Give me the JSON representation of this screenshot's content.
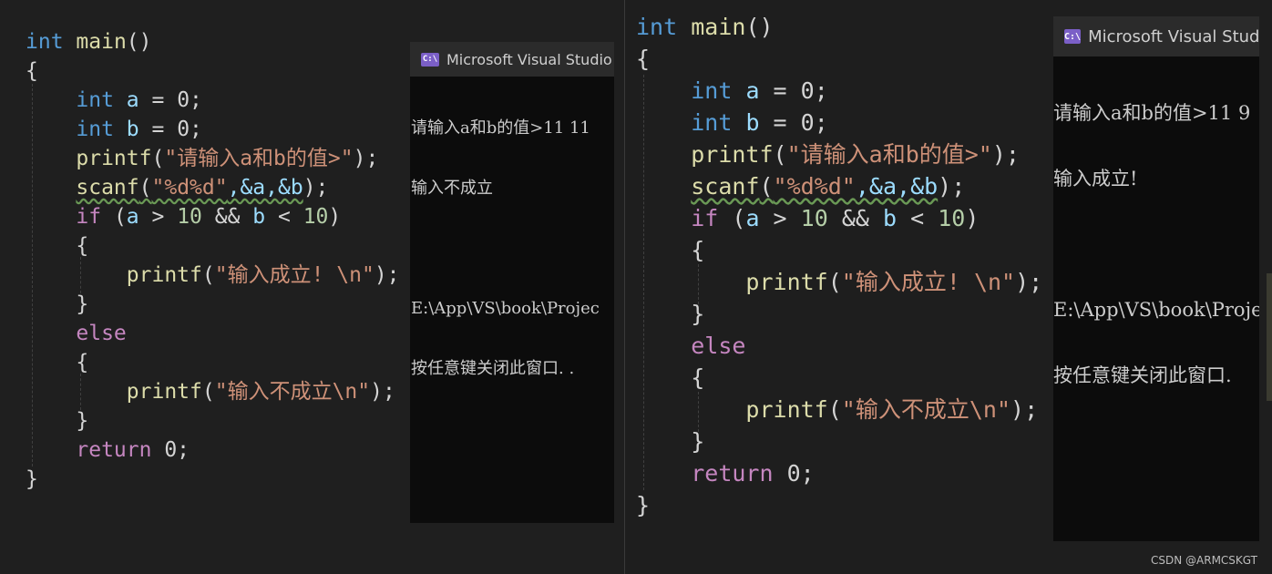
{
  "panels": {
    "left": {
      "console": {
        "title": "Microsoft Visual Studio",
        "icon": "vs-debug-console-icon",
        "lines": [
          "请输入a和b的值>11 11",
          "输入不成立",
          "",
          "E:\\App\\VS\\book\\Projec",
          "按任意键关闭此窗口. ."
        ]
      }
    },
    "right": {
      "console": {
        "title": "Microsoft Visual Stud",
        "icon": "vs-debug-console-icon",
        "lines": [
          "请输入a和b的值>11 9",
          "输入成立!",
          "",
          "E:\\App\\VS\\book\\Proje",
          "按任意键关闭此窗口."
        ]
      }
    }
  },
  "code": {
    "t_int": "int",
    "t_main": "main",
    "t_parens": "()",
    "t_open": "{",
    "t_close": "}",
    "t_a": "a",
    "t_b": "b",
    "t_assign0": " = 0;",
    "t_printf": "printf",
    "t_scanf": "scanf",
    "t_lp": "(",
    "t_rp_semi": ");",
    "s_prompt": "\"请输入a和b的值>\"",
    "s_fmt": "\"%d%d\"",
    "t_scanf_args": ",&a,&b",
    "t_if": "if",
    "t_cond_open": " (",
    "t_gt": " > ",
    "n_10": "10",
    "t_and": " && ",
    "t_lt": " < ",
    "t_rp": ")",
    "s_ok": "\"输入成立! \\n\"",
    "t_else": "else",
    "s_fail": "\"输入不成立\\n\"",
    "t_return": "return",
    "t_ret_val": " 0;"
  },
  "watermark": "CSDN @ARMCSKGT",
  "colors": {
    "keyword": "#569cd6",
    "control": "#c586c0",
    "function": "#dcdcaa",
    "string": "#ce9178",
    "variable": "#9cdcfe",
    "number": "#b5cea8"
  }
}
